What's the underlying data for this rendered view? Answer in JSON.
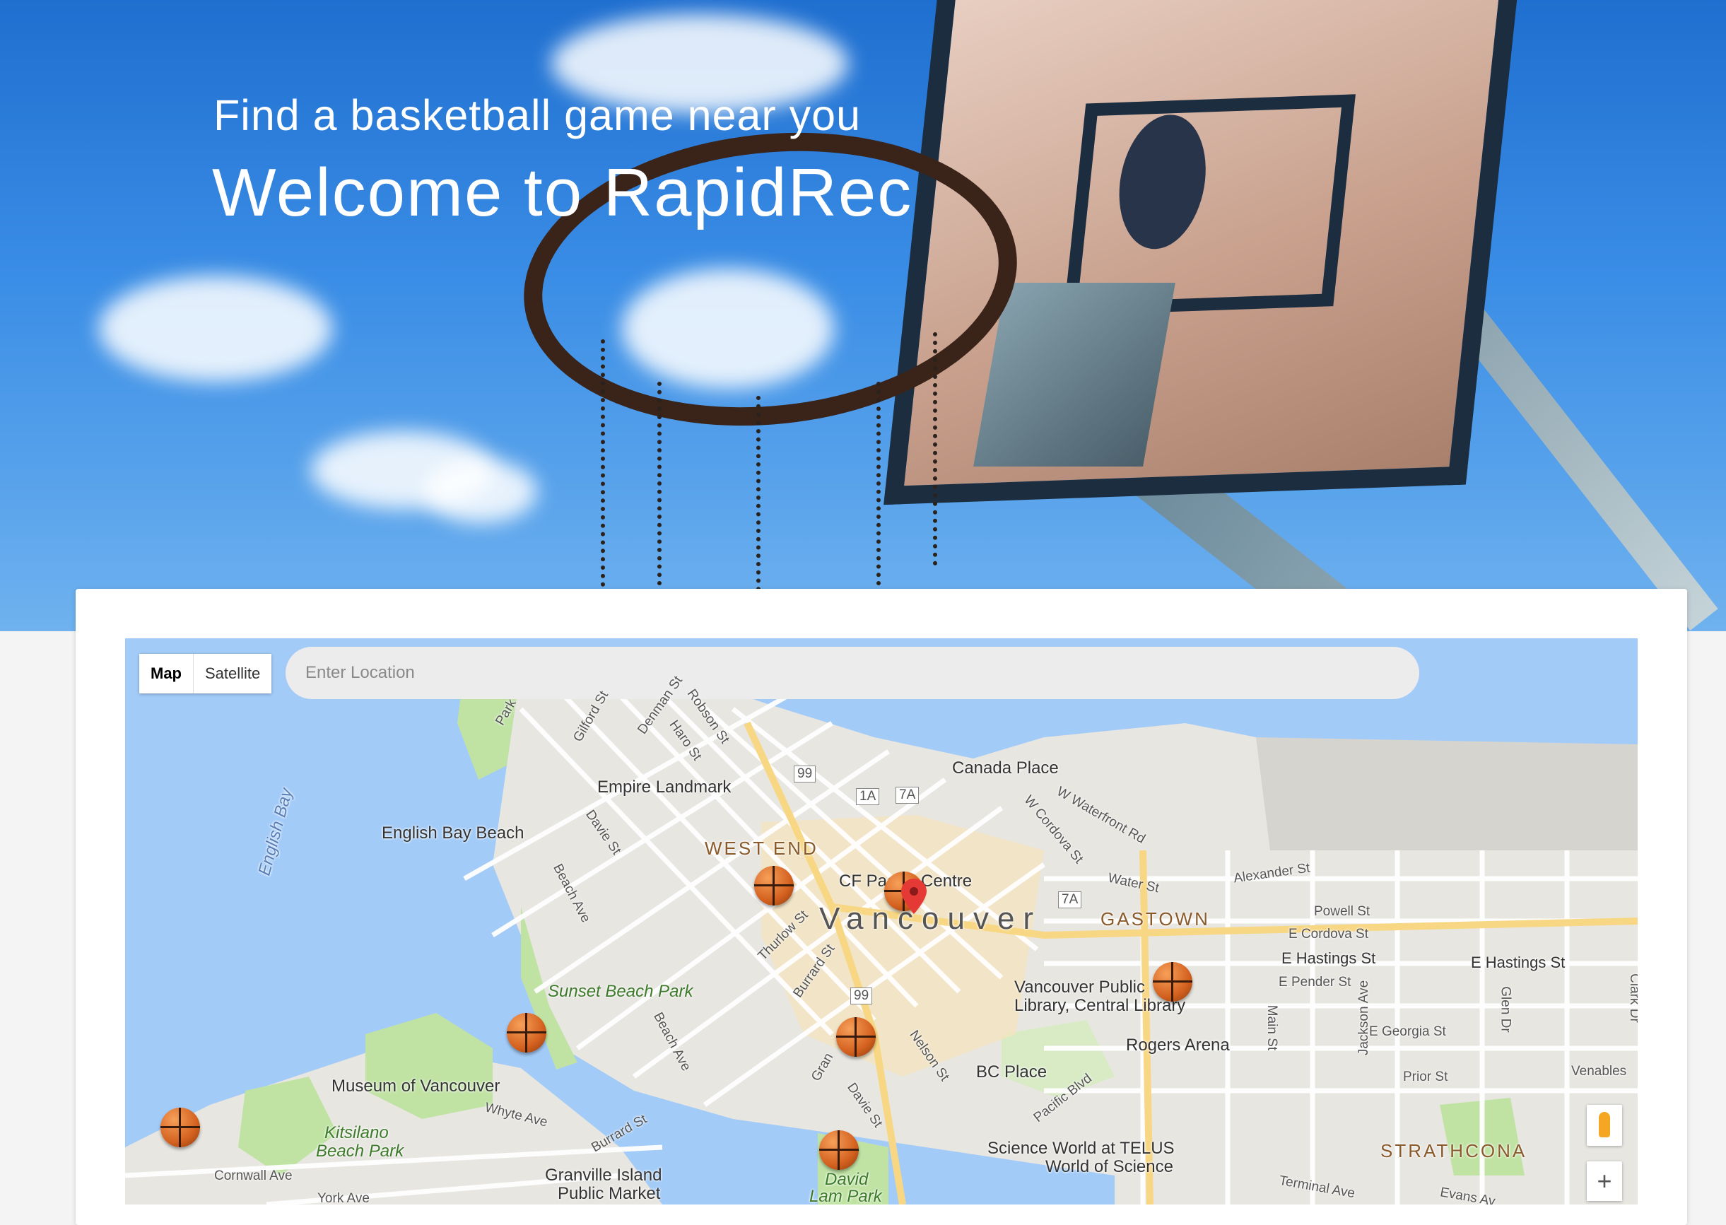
{
  "hero": {
    "subtitle": "Find a basketball game near you",
    "title": "Welcome to RapidRec"
  },
  "map": {
    "type_controls": {
      "map_label": "Map",
      "satellite_label": "Satellite",
      "active": "Map"
    },
    "search": {
      "placeholder": "Enter Location",
      "value": ""
    },
    "zoom_in_label": "+",
    "labels": {
      "canada_place": "Canada Place",
      "empire_landmark": "Empire Landmark",
      "english_bay_beach": "English Bay Beach",
      "english_bay": "English Bay",
      "west_end": "WEST END",
      "cf_pacific_centre": "CF Pacific Centre",
      "vancouver": "Vancouver",
      "gastown": "GASTOWN",
      "sunset_beach_park": "Sunset Beach Park",
      "vancouver_public_library_1": "Vancouver Public",
      "vancouver_public_library_2": "Library, Central Library",
      "rogers_arena": "Rogers Arena",
      "bc_place": "BC Place",
      "museum_of_vancouver": "Museum of Vancouver",
      "kitsilano_1": "Kitsilano",
      "kitsilano_2": "Beach Park",
      "science_world_1": "Science World at TELUS",
      "science_world_2": "World of Science",
      "strathcona": "STRATHCONA",
      "granville_island_1": "Granville Island",
      "granville_island_2": "Public Market",
      "david_lam_1": "David",
      "david_lam_2": "Lam Park",
      "cornwall_ave": "Cornwall Ave",
      "york_ave": "York Ave",
      "whyte_ave": "Whyte Ave",
      "burrard_st": "Burrard St",
      "burrard_st_2": "Burrard St",
      "beach_ave": "Beach Ave",
      "beach_ave_2": "Beach Ave",
      "davie_st": "Davie St",
      "davie_st_2": "Davie St",
      "thurlow_st": "Thurlow St",
      "nelson_st": "Nelson St",
      "pacific_blvd": "Pacific Blvd",
      "w_cordova_st": "W Cordova St",
      "w_waterfront_rd": "W Waterfront Rd",
      "water_st": "Water St",
      "alexander_st": "Alexander St",
      "powell_st": "Powell St",
      "e_cordova_st": "E Cordova St",
      "e_hastings_st": "E Hastings St",
      "e_hastings_st_2": "E Hastings St",
      "e_pender_st": "E Pender St",
      "e_georgia_st": "E Georgia St",
      "prior_st": "Prior St",
      "venables": "Venables",
      "main_st": "Main St",
      "jackson_ave": "Jackson Ave",
      "glen_dr": "Glen Dr",
      "clark_dr": "Clark Dr",
      "terminal_ave": "Terminal Ave",
      "evans_av": "Evans Av",
      "gilford_st": "Gilford St",
      "denman_st": "Denman St",
      "robson_st": "Robson St",
      "haro_st": "Haro St",
      "park": "Park",
      "granville": "Gran",
      "route_99": "99",
      "route_99_b": "99",
      "route_1a": "1A",
      "route_7a": "7A",
      "route_7a_b": "7A"
    },
    "colors": {
      "water": "#a3cbf8",
      "land": "#e8e6e1",
      "park": "#c0e3a4",
      "road": "#ffffff",
      "highway": "#f8d784"
    }
  }
}
